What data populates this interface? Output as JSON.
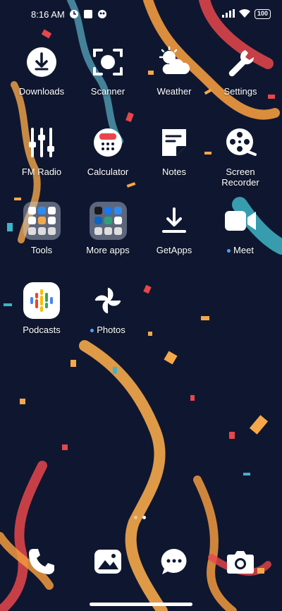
{
  "status_bar": {
    "time": "8:16 AM",
    "battery": "100"
  },
  "apps": [
    {
      "label": "Downloads",
      "icon": "download-icon"
    },
    {
      "label": "Scanner",
      "icon": "scanner-icon"
    },
    {
      "label": "Weather",
      "icon": "weather-icon"
    },
    {
      "label": "Settings",
      "icon": "wrench-icon"
    },
    {
      "label": "FM Radio",
      "icon": "fm-radio-icon"
    },
    {
      "label": "Calculator",
      "icon": "calculator-icon"
    },
    {
      "label": "Notes",
      "icon": "notes-icon"
    },
    {
      "label": "Screen Recorder",
      "icon": "film-reel-icon"
    },
    {
      "label": "Tools",
      "icon": "folder-icon"
    },
    {
      "label": "More apps",
      "icon": "folder-icon"
    },
    {
      "label": "GetApps",
      "icon": "getapps-icon"
    },
    {
      "label": "Meet",
      "icon": "video-camera-icon",
      "new_dot": true
    },
    {
      "label": "Podcasts",
      "icon": "podcasts-icon"
    },
    {
      "label": "Photos",
      "icon": "pinwheel-icon",
      "new_dot": true
    }
  ],
  "dock": [
    {
      "name": "phone-app",
      "icon": "phone-icon"
    },
    {
      "name": "gallery-app",
      "icon": "gallery-icon"
    },
    {
      "name": "messages-app",
      "icon": "message-icon"
    },
    {
      "name": "camera-app",
      "icon": "camera-icon"
    }
  ],
  "pages": {
    "count": 2,
    "active": 2
  },
  "colors": {
    "background": "#0f1730",
    "accent_dot": "#4aa3ff",
    "confetti_orange": "#f0a040",
    "confetti_red": "#e8464a"
  }
}
